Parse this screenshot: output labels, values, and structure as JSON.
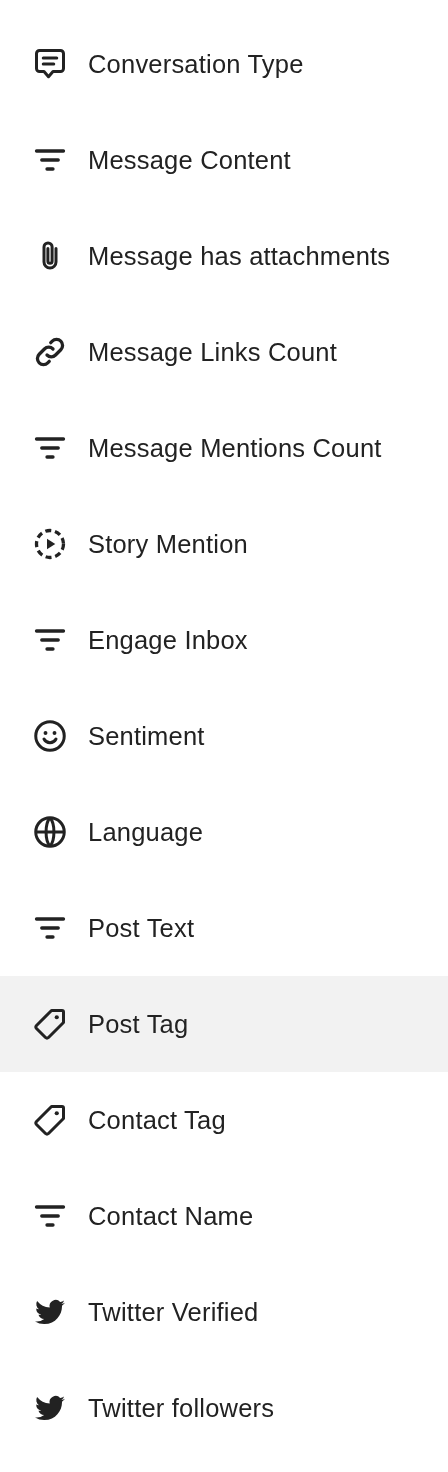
{
  "menu": {
    "items": [
      {
        "label": "Conversation Type",
        "kind": "chat",
        "selected": false
      },
      {
        "label": "Message Content",
        "kind": "filter",
        "selected": false
      },
      {
        "label": "Message has attachments",
        "kind": "paperclip",
        "selected": false
      },
      {
        "label": "Message Links Count",
        "kind": "link",
        "selected": false
      },
      {
        "label": "Message Mentions Count",
        "kind": "filter",
        "selected": false
      },
      {
        "label": "Story Mention",
        "kind": "story",
        "selected": false
      },
      {
        "label": "Engage Inbox",
        "kind": "filter",
        "selected": false
      },
      {
        "label": "Sentiment",
        "kind": "smile",
        "selected": false
      },
      {
        "label": "Language",
        "kind": "globe",
        "selected": false
      },
      {
        "label": "Post Text",
        "kind": "filter",
        "selected": false
      },
      {
        "label": "Post Tag",
        "kind": "tag",
        "selected": true
      },
      {
        "label": "Contact Tag",
        "kind": "tag",
        "selected": false
      },
      {
        "label": "Contact Name",
        "kind": "filter",
        "selected": false
      },
      {
        "label": "Twitter Verified",
        "kind": "bird",
        "selected": false
      },
      {
        "label": "Twitter followers",
        "kind": "bird",
        "selected": false
      }
    ]
  }
}
